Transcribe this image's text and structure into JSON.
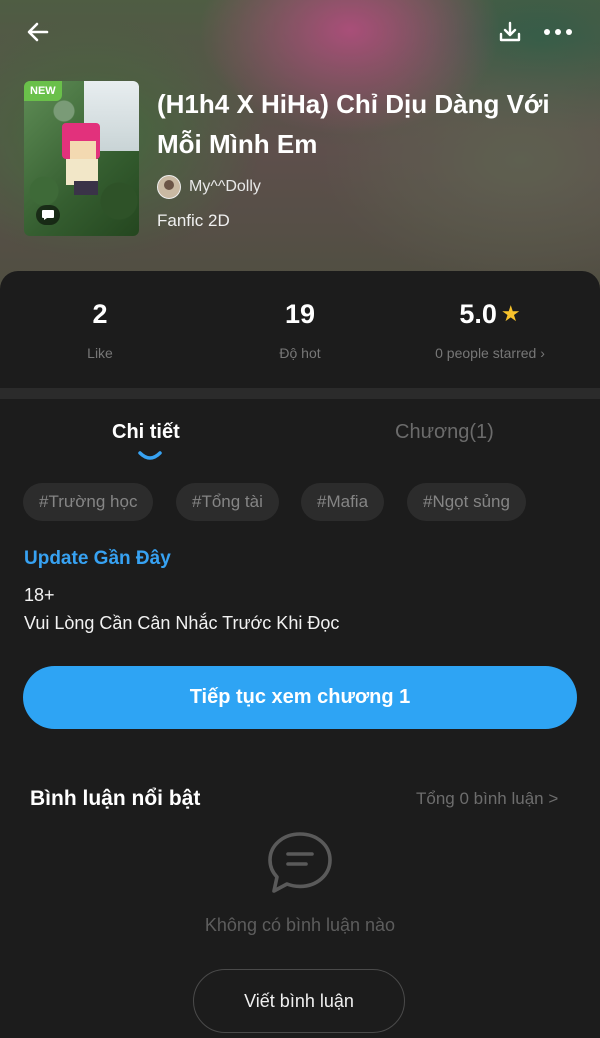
{
  "header": {
    "badge_new": "NEW",
    "title": "(H1h4 X HiHa) Chỉ Dịu Dàng Với Mỗi Mình Em",
    "author": "My^^Dolly",
    "genre": "Fanfic 2D",
    "icons": [
      "back-arrow-icon",
      "download-icon",
      "more-icon"
    ]
  },
  "stats": [
    {
      "value": "2",
      "label": "Like"
    },
    {
      "value": "19",
      "label": "Độ hot"
    },
    {
      "value": "5.0",
      "label": "0 people starred ›"
    }
  ],
  "tabs": [
    {
      "label": "Chi tiết",
      "active": true
    },
    {
      "label": "Chương(1)",
      "active": false
    }
  ],
  "tags": [
    "#Trường học",
    "#Tổng tài",
    "#Mafia",
    "#Ngọt sủng"
  ],
  "update": {
    "title": "Update Gần Đây",
    "line1": "18+",
    "line2": "Vui Lòng Cần Cân Nhắc Trước Khi Đọc"
  },
  "cta_label": "Tiếp tục xem chương 1",
  "comments": {
    "title": "Bình luận nổi bật",
    "total": "Tổng 0 bình luận >",
    "empty": "Không có bình luận nào",
    "write_button": "Viết bình luận"
  },
  "colors": {
    "accent": "#2ea4f4",
    "update_title": "#37a2f2",
    "star": "#f7c22c",
    "background": "#1c1c1c"
  }
}
